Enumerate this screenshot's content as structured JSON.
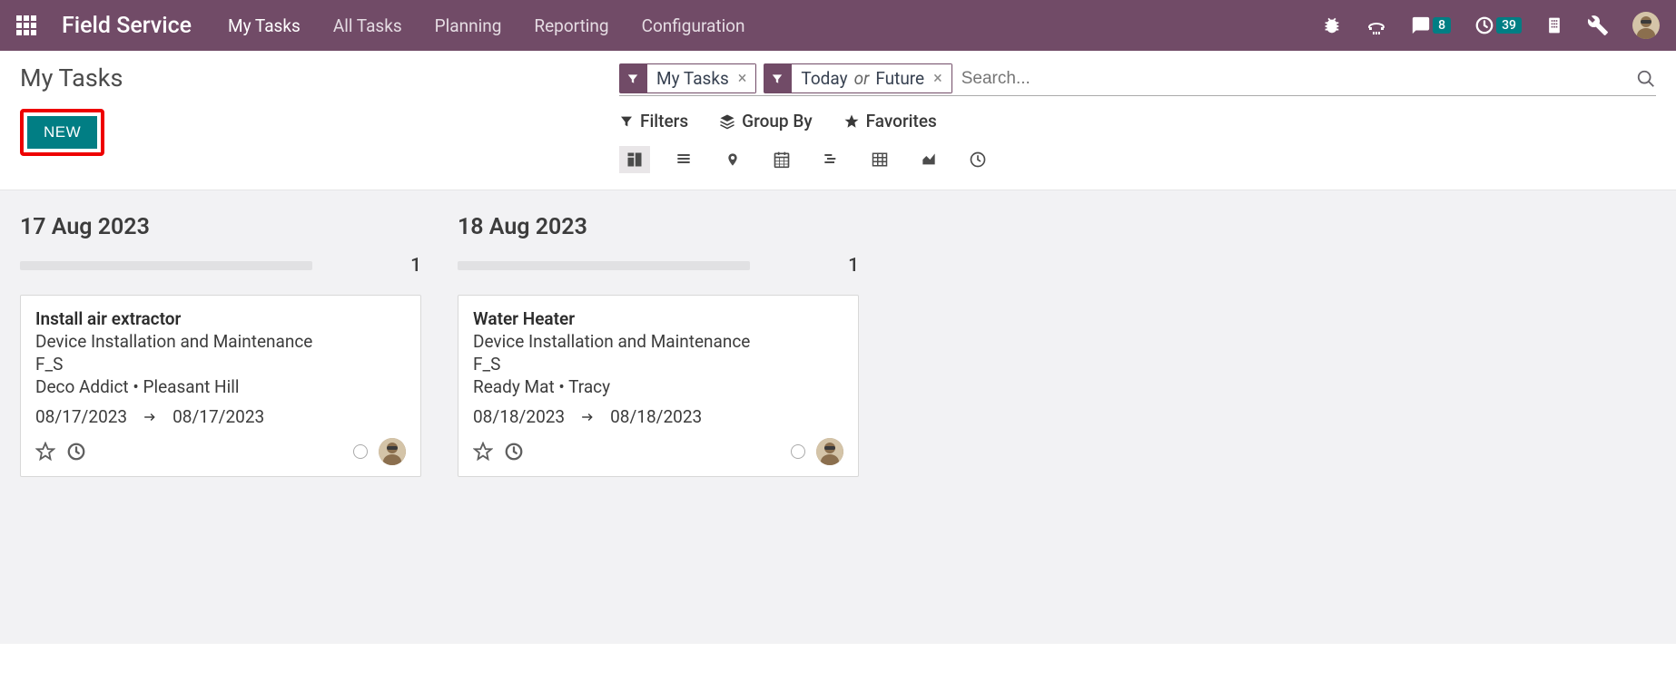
{
  "brand": "Field Service",
  "nav": {
    "items": [
      "My Tasks",
      "All Tasks",
      "Planning",
      "Reporting",
      "Configuration"
    ],
    "badges": {
      "messages": "8",
      "activities": "39"
    }
  },
  "breadcrumb": "My Tasks",
  "new_button": "NEW",
  "search": {
    "filters": [
      {
        "label": "My Tasks"
      },
      {
        "label_a": "Today",
        "or": "or",
        "label_b": "Future"
      }
    ],
    "placeholder": "Search..."
  },
  "toolbar": {
    "filters": "Filters",
    "group_by": "Group By",
    "favorites": "Favorites"
  },
  "columns": [
    {
      "title": "17 Aug 2023",
      "count": "1",
      "card": {
        "title": "Install air extractor",
        "project": "Device Installation and Maintenance",
        "code": "F_S",
        "location": "Deco Addict • Pleasant Hill",
        "date_from": "08/17/2023",
        "date_to": "08/17/2023"
      }
    },
    {
      "title": "18 Aug 2023",
      "count": "1",
      "card": {
        "title": "Water Heater",
        "project": "Device Installation and Maintenance",
        "code": "F_S",
        "location": "Ready Mat • Tracy",
        "date_from": "08/18/2023",
        "date_to": "08/18/2023"
      }
    }
  ]
}
